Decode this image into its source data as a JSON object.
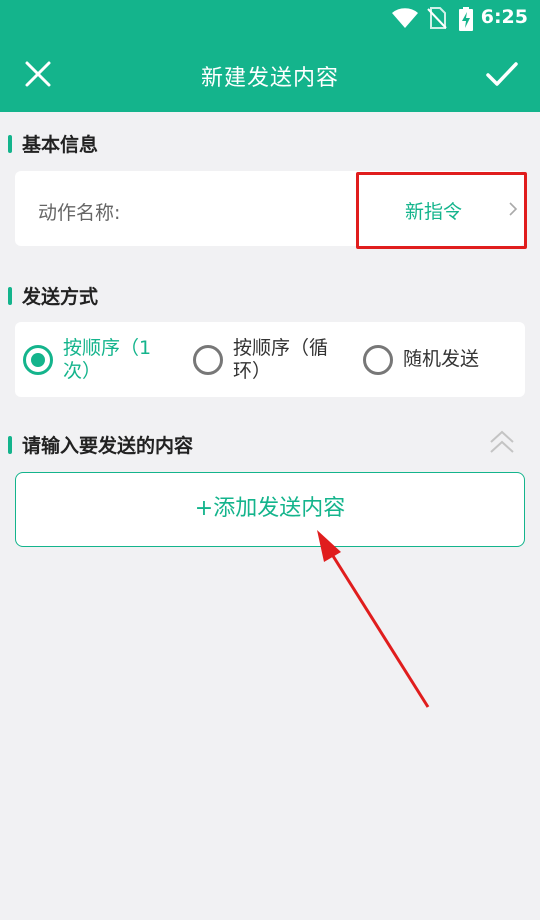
{
  "status_bar": {
    "time": "6:25",
    "icons": [
      "wifi-icon",
      "no-sim-icon",
      "battery-charging-icon"
    ]
  },
  "app_bar": {
    "title": "新建发送内容",
    "close_icon": "close-icon",
    "confirm_icon": "check-icon"
  },
  "basic_info": {
    "section_title": "基本信息",
    "action_name_label": "动作名称:",
    "action_name_value": "新指令"
  },
  "send_mode": {
    "section_title": "发送方式",
    "options": [
      {
        "label": "按顺序（1次）",
        "checked": true
      },
      {
        "label": "按顺序（循环）",
        "checked": false
      },
      {
        "label": "随机发送",
        "checked": false
      }
    ]
  },
  "content": {
    "section_title": "请输入要发送的内容",
    "add_button_label": "+添加发送内容"
  },
  "colors": {
    "primary": "#14b48c",
    "annotation_red": "#e01d1d",
    "background": "#f1f1f3"
  }
}
